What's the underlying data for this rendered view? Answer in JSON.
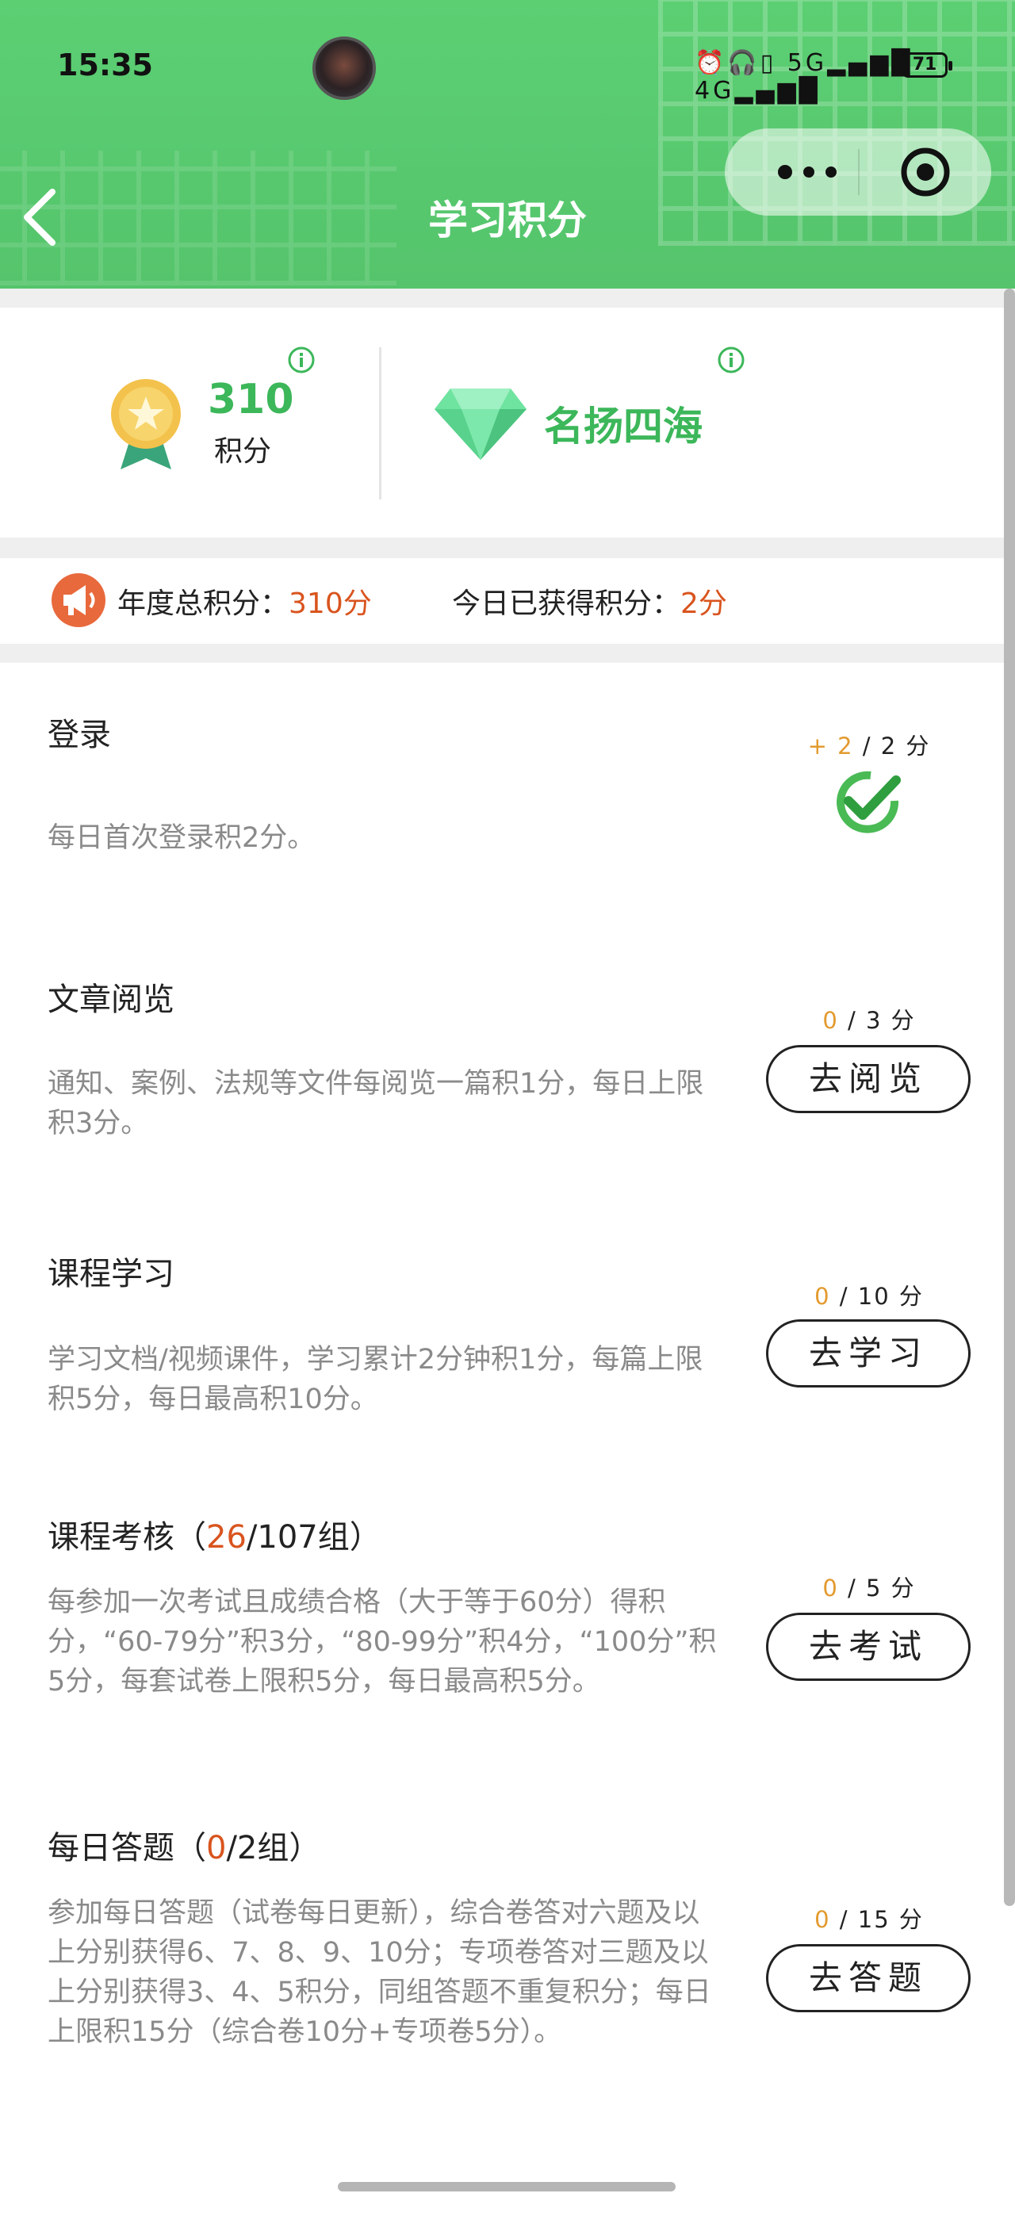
{
  "status_bar": {
    "time": "15:35",
    "signal_text": "⏰🎧▯ 5G▂▄▆█ 4G▂▄▆█",
    "battery": "71"
  },
  "header": {
    "title": "学习积分",
    "colors": {
      "green": "#5ccf73",
      "accent_green": "#3cb75a",
      "highlight": "#d9541e",
      "orange": "#e39a2e"
    }
  },
  "summary": {
    "points_value": "310",
    "points_label": "积分",
    "level_name": "名扬四海"
  },
  "totals": {
    "annual_label": "年度总积分：",
    "annual_value": "310分",
    "today_label": "今日已获得积分：",
    "today_value": "2分"
  },
  "tasks": [
    {
      "title": "登录",
      "title_count": "",
      "title_total": "",
      "description": "每日首次登录积2分。",
      "earned": "+ 2",
      "limit": " / 2 分",
      "status": "completed"
    },
    {
      "title": "文章阅览",
      "description": "通知、案例、法规等文件每阅览一篇积1分，每日上限积3分。",
      "earned": "0",
      "limit": " / 3 分",
      "button": "去阅览"
    },
    {
      "title": "课程学习",
      "description": "学习文档/视频课件，学习累计2分钟积1分，每篇上限积5分，每日最高积10分。",
      "earned": "0",
      "limit": " / 10 分",
      "button": "去学习"
    },
    {
      "title": "课程考核（",
      "title_count": "26",
      "title_total": "/107组）",
      "description": "每参加一次考试且成绩合格（大于等于60分）得积分，“60-79分”积3分，“80-99分”积4分，“100分”积5分，每套试卷上限积5分，每日最高积5分。",
      "earned": "0",
      "limit": " / 5 分",
      "button": "去考试"
    },
    {
      "title": "每日答题（",
      "title_count": "0",
      "title_total": "/2组）",
      "description": "参加每日答题（试卷每日更新），综合卷答对六题及以上分别获得6、7、8、9、10分；专项卷答对三题及以上分别获得3、4、5积分，同组答题不重复积分；每日上限积15分（综合卷10分+专项卷5分）。",
      "earned": "0",
      "limit": " / 15 分",
      "button": "去答题"
    }
  ]
}
